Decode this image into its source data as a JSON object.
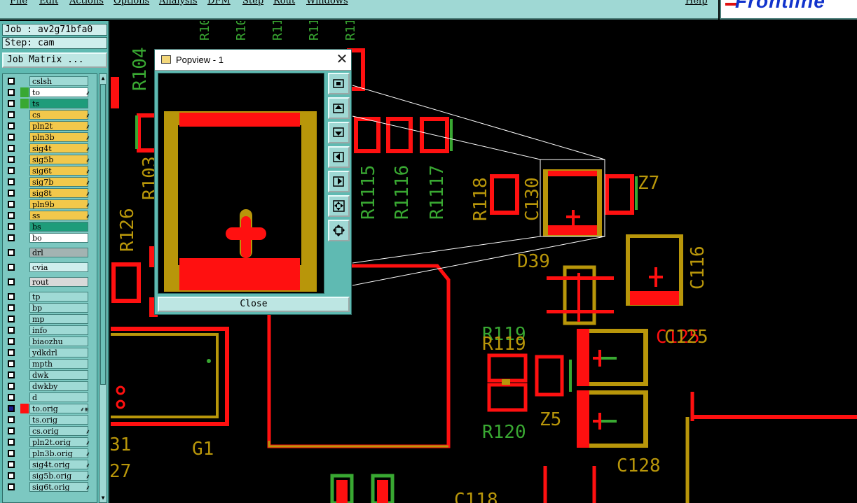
{
  "menu": [
    "File",
    "Edit",
    "Actions",
    "Options",
    "Analysis",
    "DFM",
    "Step",
    "Rout",
    "Windows"
  ],
  "help": "Help",
  "logo": "Frontline",
  "job_line": "Job : av2g71bfa0",
  "step_line": "Step: cam",
  "job_matrix": "Job Matrix ...",
  "colors": {
    "pad_red": "#ff1010",
    "pad_gold": "#b8960a",
    "silk_green": "#39a832",
    "panel": "#5fbab2",
    "layer_gold": "#f2c84b",
    "layer_teal": "#1e9c7a",
    "layer_white": "#ffffff"
  },
  "layers": [
    {
      "name": "cslsh",
      "box": "#9fdad5"
    },
    {
      "name": "to",
      "box": "#ffffff",
      "swatch": "#39a832",
      "flag": "⸙"
    },
    {
      "name": "ts",
      "box": "#1e9c7a",
      "swatch": "#39a832"
    },
    {
      "name": "cs",
      "box": "#f2c84b",
      "flag": "⸙"
    },
    {
      "name": "pln2t",
      "box": "#f2c84b",
      "flag": "⸙"
    },
    {
      "name": "pln3b",
      "box": "#f2c84b",
      "flag": "⸙"
    },
    {
      "name": "sig4t",
      "box": "#f2c84b",
      "flag": "⸙"
    },
    {
      "name": "sig5b",
      "box": "#f2c84b",
      "flag": "⸙"
    },
    {
      "name": "sig6t",
      "box": "#f2c84b",
      "flag": "⸙"
    },
    {
      "name": "sig7b",
      "box": "#f2c84b",
      "flag": "⸙"
    },
    {
      "name": "sig8t",
      "box": "#f2c84b",
      "flag": "⸙"
    },
    {
      "name": "pln9b",
      "box": "#f2c84b",
      "flag": "⸙"
    },
    {
      "name": "ss",
      "box": "#f2c84b",
      "flag": "⸙"
    },
    {
      "name": "bs",
      "box": "#1e9c7a"
    },
    {
      "name": "bo",
      "box": "#ffffff"
    },
    {
      "name": "drl",
      "box": "#a3b3b2"
    },
    {
      "name": "cvia",
      "box": "#cfeeed"
    },
    {
      "name": "rout",
      "box": "#d9d9d9"
    },
    {
      "name": "tp",
      "box": "#9fdad5"
    },
    {
      "name": "bp",
      "box": "#9fdad5"
    },
    {
      "name": "mp",
      "box": "#9fdad5"
    },
    {
      "name": "info",
      "box": "#9fdad5"
    },
    {
      "name": "biaozhu",
      "box": "#9fdad5"
    },
    {
      "name": "ydkdrl",
      "box": "#9fdad5"
    },
    {
      "name": "mpth",
      "box": "#9fdad5"
    },
    {
      "name": "dwk",
      "box": "#9fdad5"
    },
    {
      "name": "dwkby",
      "box": "#9fdad5"
    },
    {
      "name": "d",
      "box": "#9fdad5"
    },
    {
      "name": "to.orig",
      "box": "#9fdad5",
      "swatch": "#ff1010",
      "checked": true,
      "flag": "⸙⊞"
    },
    {
      "name": "ts.orig",
      "box": "#9fdad5"
    },
    {
      "name": "cs.orig",
      "box": "#9fdad5",
      "flag": "⸙"
    },
    {
      "name": "pln2t.orig",
      "box": "#9fdad5",
      "flag": "⸙"
    },
    {
      "name": "pln3b.orig",
      "box": "#9fdad5",
      "flag": "⸙"
    },
    {
      "name": "sig4t.orig",
      "box": "#9fdad5",
      "flag": "⸙"
    },
    {
      "name": "sig5b.orig",
      "box": "#9fdad5",
      "flag": "⸙"
    },
    {
      "name": "sig6t.orig",
      "box": "#9fdad5",
      "flag": "⸙"
    }
  ],
  "pcb_labels": [
    {
      "text": "R104",
      "color": "#39a832"
    },
    {
      "text": "R10",
      "color": "#39a832"
    },
    {
      "text": "R10",
      "color": "#39a832"
    },
    {
      "text": "R11",
      "color": "#39a832"
    },
    {
      "text": "R11",
      "color": "#39a832"
    },
    {
      "text": "R11",
      "color": "#39a832"
    },
    {
      "text": "R103",
      "color": "#b8960a"
    },
    {
      "text": "R1115",
      "color": "#39a832"
    },
    {
      "text": "R1116",
      "color": "#39a832"
    },
    {
      "text": "R1117",
      "color": "#39a832"
    },
    {
      "text": "R118",
      "color": "#b8960a"
    },
    {
      "text": "C130",
      "color": "#b8960a"
    },
    {
      "text": "Z7",
      "color": "#b8960a"
    },
    {
      "text": "R126",
      "color": "#b8960a"
    },
    {
      "text": "D39",
      "color": "#b8960a"
    },
    {
      "text": "C116",
      "color": "#b8960a"
    },
    {
      "text": "R119",
      "color": "#39a832"
    },
    {
      "text": "R119",
      "color": "#b8960a"
    },
    {
      "text": "C125",
      "color": "#ff1010"
    },
    {
      "text": "C125",
      "color": "#b8960a"
    },
    {
      "text": "Z5",
      "color": "#b8960a"
    },
    {
      "text": "R120",
      "color": "#39a832"
    },
    {
      "text": "G1",
      "color": "#b8960a"
    },
    {
      "text": "C128",
      "color": "#b8960a"
    },
    {
      "text": "31",
      "color": "#b8960a"
    },
    {
      "text": "27",
      "color": "#b8960a"
    },
    {
      "text": "C118",
      "color": "#b8960a"
    }
  ],
  "popview": {
    "title": "Popview - 1",
    "close_label": "Close",
    "buttons": [
      "zoom-fit-icon",
      "pan-up-icon",
      "pan-down-icon",
      "pan-left-icon",
      "pan-right-icon",
      "zoom-in-icon",
      "zoom-out-icon"
    ]
  }
}
